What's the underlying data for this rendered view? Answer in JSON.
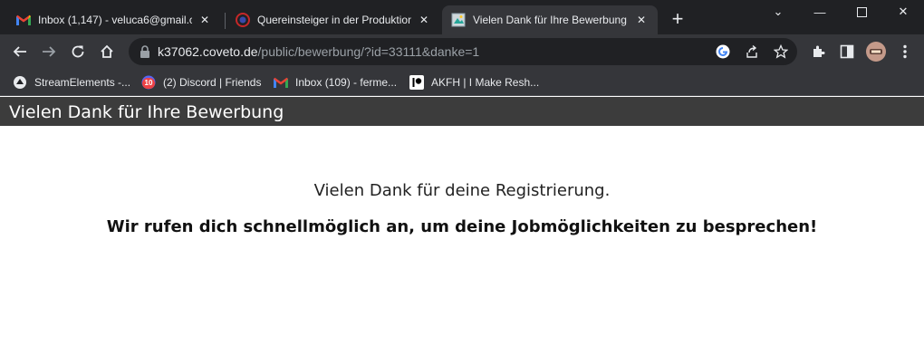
{
  "browser": {
    "tabs": [
      {
        "title": "Inbox (1,147) - veluca6@gmail.co",
        "favicon": "gmail-icon",
        "active": false
      },
      {
        "title": "Quereinsteiger in der Produktion",
        "favicon": "firefox-like-icon",
        "active": false
      },
      {
        "title": "Vielen Dank für Ihre Bewerbung",
        "favicon": "page-icon",
        "active": true
      }
    ],
    "new_tab_label": "+",
    "url_host": "k37062.coveto.de",
    "url_path": "/public/bewerbung/?id=33111&danke=1",
    "bookmarks": [
      {
        "label": "StreamElements -...",
        "icon": "streamelements-icon"
      },
      {
        "label": "(2) Discord | Friends",
        "icon": "discord-icon",
        "badge": "10"
      },
      {
        "label": "Inbox (109) - ferme...",
        "icon": "gmail-icon"
      },
      {
        "label": "AKFH | I Make Resh...",
        "icon": "patreon-icon"
      }
    ]
  },
  "page": {
    "header_title": "Vielen Dank für Ihre Bewerbung",
    "message": "Vielen Dank für deine Registrierung.",
    "message_bold": "Wir rufen dich schnellmöglich an, um deine Jobmöglichkeiten zu besprechen!"
  },
  "colors": {
    "tabstrip_bg": "#202124",
    "toolbar_bg": "#35363a",
    "page_header_bg": "#3c3c3c",
    "gmail_red": "#ea4335"
  }
}
